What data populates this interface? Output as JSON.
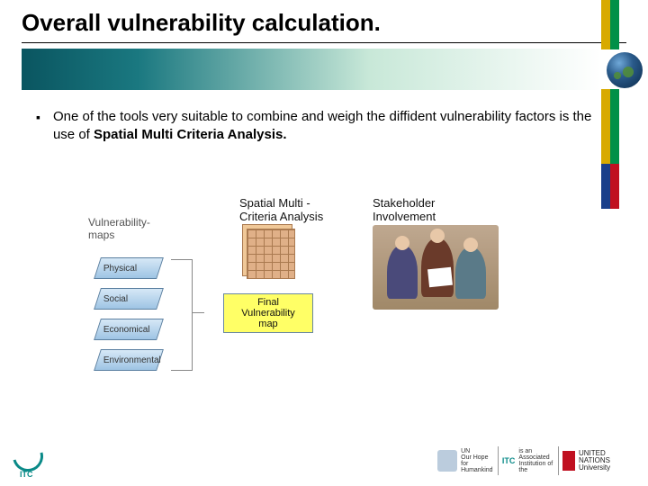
{
  "title": "Overall vulnerability calculation.",
  "bullet_text_1": "One of the tools very suitable to combine and weigh the diffident vulnerability factors is the use of ",
  "bullet_bold": "Spatial Multi Criteria Analysis.",
  "diagram": {
    "vuln_label": "Vulnerability-\nmaps",
    "smca_label": "Spatial Multi -\nCriteria  Analysis",
    "stakeholder_label": "Stakeholder\nInvolvement",
    "factors": [
      "Physical",
      "Social",
      "Economical",
      "Environmental"
    ],
    "final_box": "Final\nVulnerability\nmap"
  },
  "footer": {
    "itc": "ITC",
    "un_text": "UN\nOur Hope for\nHumankind",
    "assoc_text": "is an Associated Institution of the",
    "unu_text": "UNITED NATIONS\nUniversity"
  }
}
